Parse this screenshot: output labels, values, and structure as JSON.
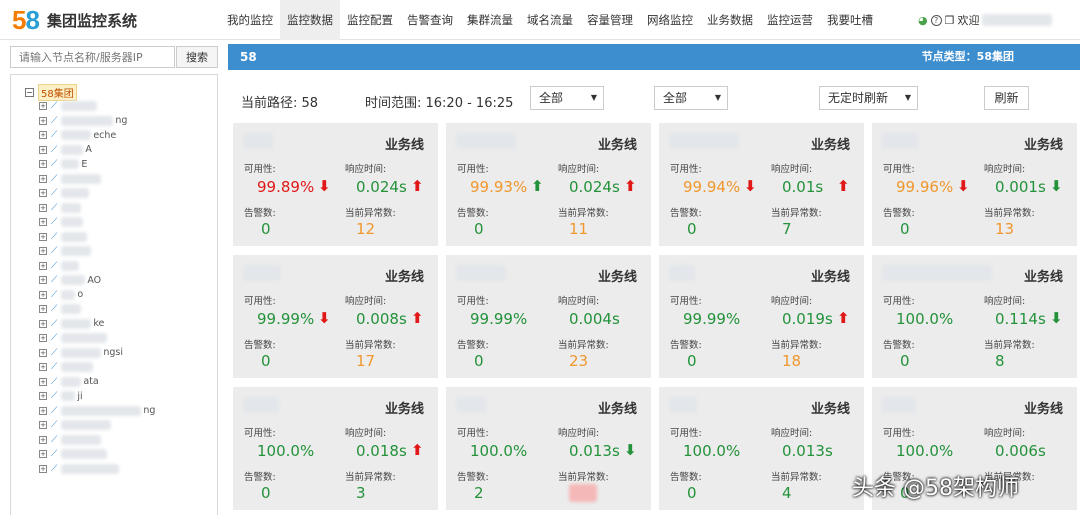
{
  "app": {
    "logo_text": "58",
    "title": "集团监控系统"
  },
  "nav": [
    {
      "label": "我的监控",
      "active": false
    },
    {
      "label": "监控数据",
      "active": true
    },
    {
      "label": "监控配置",
      "active": false
    },
    {
      "label": "告警查询",
      "active": false
    },
    {
      "label": "集群流量",
      "active": false
    },
    {
      "label": "域名流量",
      "active": false
    },
    {
      "label": "容量管理",
      "active": false
    },
    {
      "label": "网络监控",
      "active": false
    },
    {
      "label": "业务数据",
      "active": false
    },
    {
      "label": "监控运营",
      "active": false
    },
    {
      "label": "我要吐槽",
      "active": false
    }
  ],
  "user": {
    "welcome": "欢迎"
  },
  "search": {
    "placeholder": "请输入节点名称/服务器IP",
    "button": "搜索"
  },
  "tree": {
    "root": "58集团",
    "items": [
      "",
      "ng",
      "eche",
      "A",
      "E",
      "",
      "",
      "",
      "",
      "",
      "",
      "",
      "AO",
      "o",
      "",
      "ke",
      "",
      "ngsi",
      "",
      "ata",
      "ji",
      "ng",
      "",
      "",
      "",
      ""
    ]
  },
  "main": {
    "node": "58",
    "node_type": "节点类型：58集团"
  },
  "filters": {
    "path_label": "当前路径: 58",
    "time_label": "时间范围: 16:20 - 16:25",
    "select1": "全部",
    "select2": "全部",
    "refresh_select": "无定时刷新",
    "refresh_button": "刷新"
  },
  "card_labels": {
    "type": "业务线",
    "availability": "可用性:",
    "response": "响应时间:",
    "alarms": "告警数:",
    "anomalies": "当前异常数:"
  },
  "cards": [
    {
      "avail": "99.89%",
      "avail_color": "red",
      "avail_arrow": "down",
      "resp": "0.024s",
      "resp_arrow": "up",
      "alarms": "0",
      "anomalies": "12",
      "anomaly_color": "orange"
    },
    {
      "avail": "99.93%",
      "avail_color": "orange",
      "avail_arrow": "up",
      "resp": "0.024s",
      "resp_arrow": "up",
      "alarms": "0",
      "anomalies": "11",
      "anomaly_color": "orange"
    },
    {
      "avail": "99.94%",
      "avail_color": "orange",
      "avail_arrow": "down",
      "resp": "0.01s",
      "resp_arrow": "up",
      "alarms": "0",
      "anomalies": "7",
      "anomaly_color": "green"
    },
    {
      "avail": "99.96%",
      "avail_color": "orange",
      "avail_arrow": "down",
      "resp": "0.001s",
      "resp_arrow": "down",
      "alarms": "0",
      "anomalies": "13",
      "anomaly_color": "orange"
    },
    {
      "avail": "99.99%",
      "avail_color": "green",
      "avail_arrow": "down",
      "resp": "0.008s",
      "resp_arrow": "up",
      "alarms": "0",
      "anomalies": "17",
      "anomaly_color": "orange"
    },
    {
      "avail": "99.99%",
      "avail_color": "green",
      "avail_arrow": "",
      "resp": "0.004s",
      "resp_arrow": "",
      "alarms": "0",
      "anomalies": "23",
      "anomaly_color": "orange"
    },
    {
      "avail": "99.99%",
      "avail_color": "green",
      "avail_arrow": "",
      "resp": "0.019s",
      "resp_arrow": "up",
      "alarms": "0",
      "anomalies": "18",
      "anomaly_color": "orange"
    },
    {
      "avail": "100.0%",
      "avail_color": "green",
      "avail_arrow": "",
      "resp": "0.114s",
      "resp_arrow": "down",
      "alarms": "0",
      "anomalies": "8",
      "anomaly_color": "green"
    },
    {
      "avail": "100.0%",
      "avail_color": "green",
      "avail_arrow": "",
      "resp": "0.018s",
      "resp_arrow": "up",
      "alarms": "0",
      "anomalies": "3",
      "anomaly_color": "green"
    },
    {
      "avail": "100.0%",
      "avail_color": "green",
      "avail_arrow": "",
      "resp": "0.013s",
      "resp_arrow": "down",
      "alarms": "2",
      "anomalies": "",
      "anomaly_color": "green"
    },
    {
      "avail": "100.0%",
      "avail_color": "green",
      "avail_arrow": "",
      "resp": "0.013s",
      "resp_arrow": "",
      "alarms": "0",
      "anomalies": "4",
      "anomaly_color": "green"
    },
    {
      "avail": "100.0%",
      "avail_color": "green",
      "avail_arrow": "",
      "resp": "0.006s",
      "resp_arrow": "",
      "alarms": "0",
      "anomalies": "",
      "anomaly_color": "green"
    }
  ],
  "watermark": "头条 @58架构师"
}
